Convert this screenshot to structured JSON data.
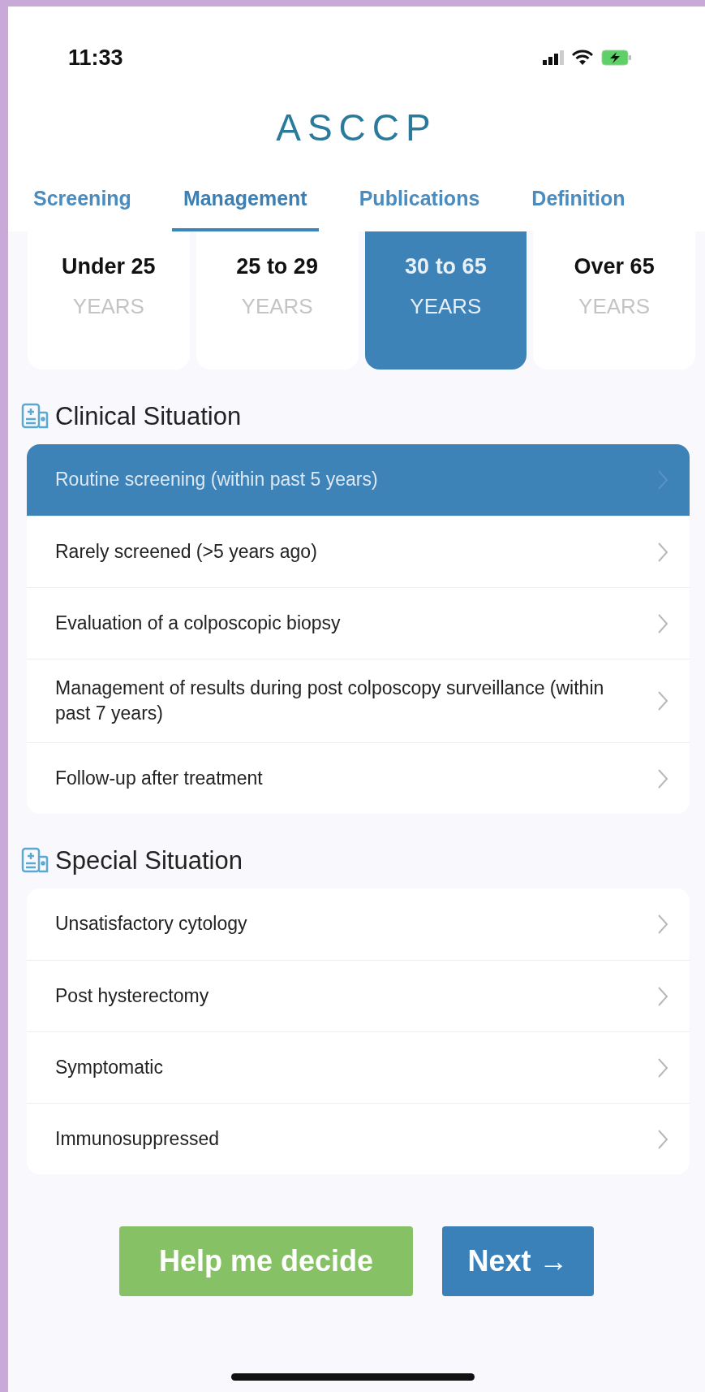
{
  "status_bar": {
    "time": "11:33",
    "battery_charging": true
  },
  "logo": {
    "text": "ASCCP"
  },
  "tabs": [
    {
      "label": "Screening",
      "selected": false
    },
    {
      "label": "Management",
      "selected": true
    },
    {
      "label": "Publications",
      "selected": false
    },
    {
      "label": "Definition",
      "selected": false
    }
  ],
  "age_groups": [
    {
      "label": "Under 25",
      "unit": "YEARS",
      "selected": false
    },
    {
      "label": "25 to 29",
      "unit": "YEARS",
      "selected": false
    },
    {
      "label": "30 to 65",
      "unit": "YEARS",
      "selected": true
    },
    {
      "label": "Over 65",
      "unit": "YEARS",
      "selected": false
    }
  ],
  "sections": [
    {
      "title": "Clinical Situation",
      "items": [
        {
          "label": "Routine screening (within past 5 years)",
          "selected": true
        },
        {
          "label": "Rarely screened (>5 years ago)",
          "selected": false
        },
        {
          "label": "Evaluation of a colposcopic biopsy",
          "selected": false
        },
        {
          "label": "Management of results during post colposcopy surveillance (within past 7 years)",
          "selected": false
        },
        {
          "label": "Follow-up after treatment",
          "selected": false
        }
      ]
    },
    {
      "title": "Special Situation",
      "items": [
        {
          "label": "Unsatisfactory cytology",
          "selected": false
        },
        {
          "label": "Post hysterectomy",
          "selected": false
        },
        {
          "label": "Symptomatic",
          "selected": false
        },
        {
          "label": "Immunosuppressed",
          "selected": false
        }
      ]
    }
  ],
  "buttons": [
    {
      "label": "Help me decide",
      "kind": "secondary"
    },
    {
      "label": "Next →",
      "kind": "primary"
    }
  ]
}
